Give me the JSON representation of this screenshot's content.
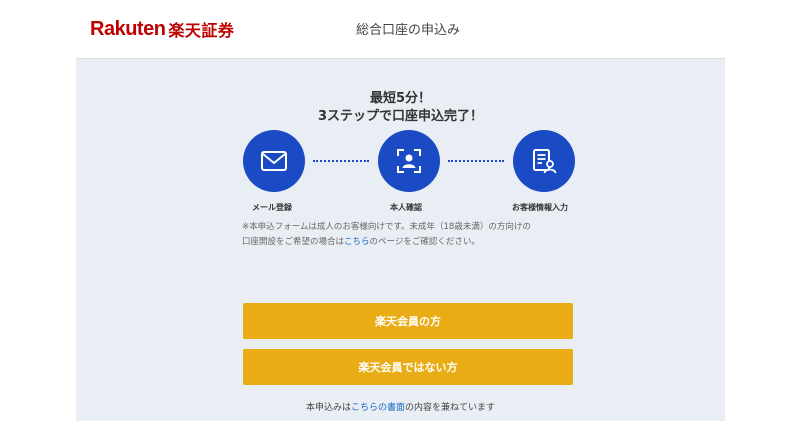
{
  "header": {
    "logo_en": "Rakuten",
    "logo_ja": "楽天証券",
    "title": "総合口座の申込み"
  },
  "headline": {
    "line1": "最短5分！",
    "line2": "3ステップで口座申込完了！"
  },
  "steps": [
    {
      "label": "メール登録",
      "icon": "mail-icon"
    },
    {
      "label": "本人確認",
      "icon": "id-scan-icon"
    },
    {
      "label": "お客様情報入力",
      "icon": "form-user-icon"
    }
  ],
  "notice": {
    "line1": "※本申込フォームは成人のお客様向けです。未成年（18歳未満）の方向けの",
    "line2_pre": "口座開設をご希望の場合は",
    "line2_link": "こちら",
    "line2_post": "のページをご確認ください。"
  },
  "buttons": {
    "member": "楽天会員の方",
    "non_member": "楽天会員ではない方"
  },
  "footer": {
    "pre": "本申込みは",
    "link": "こちらの書面",
    "post": "の内容を兼ねています"
  },
  "colors": {
    "brand_red": "#bf0000",
    "step_blue": "#1a4bc4",
    "button_gold": "#eaac14",
    "panel_bg": "#e9eef4",
    "link_blue": "#1a66c4"
  }
}
